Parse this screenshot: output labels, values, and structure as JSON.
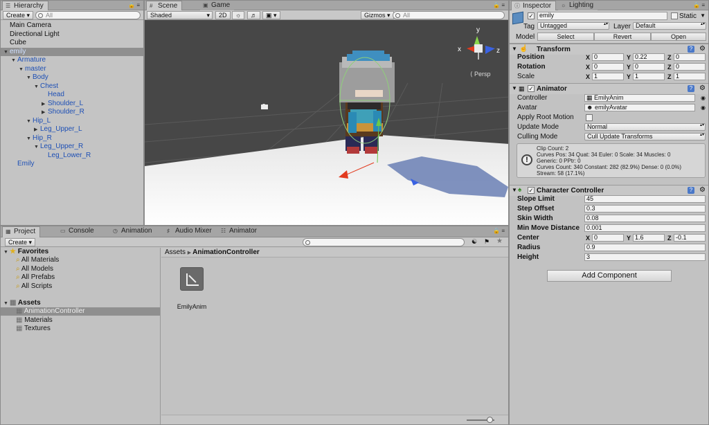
{
  "hierarchy": {
    "tab": "Hierarchy",
    "create": "Create",
    "search_placeholder": "All",
    "items": [
      {
        "label": "Main Camera",
        "indent": 0,
        "arrow": "",
        "blue": false,
        "selected": false
      },
      {
        "label": "Directional Light",
        "indent": 0,
        "arrow": "",
        "blue": false,
        "selected": false
      },
      {
        "label": "Cube",
        "indent": 0,
        "arrow": "",
        "blue": false,
        "selected": false
      },
      {
        "label": "emily",
        "indent": 0,
        "arrow": "down",
        "blue": true,
        "selected": true
      },
      {
        "label": "Armature",
        "indent": 1,
        "arrow": "down",
        "blue": true,
        "selected": false
      },
      {
        "label": "master",
        "indent": 2,
        "arrow": "down",
        "blue": true,
        "selected": false
      },
      {
        "label": "Body",
        "indent": 3,
        "arrow": "down",
        "blue": true,
        "selected": false
      },
      {
        "label": "Chest",
        "indent": 4,
        "arrow": "down",
        "blue": true,
        "selected": false
      },
      {
        "label": "Head",
        "indent": 5,
        "arrow": "",
        "blue": true,
        "selected": false
      },
      {
        "label": "Shoulder_L",
        "indent": 5,
        "arrow": "right",
        "blue": true,
        "selected": false
      },
      {
        "label": "Shoulder_R",
        "indent": 5,
        "arrow": "right",
        "blue": true,
        "selected": false
      },
      {
        "label": "Hip_L",
        "indent": 3,
        "arrow": "down",
        "blue": true,
        "selected": false
      },
      {
        "label": "Leg_Upper_L",
        "indent": 4,
        "arrow": "right",
        "blue": true,
        "selected": false
      },
      {
        "label": "Hip_R",
        "indent": 3,
        "arrow": "down",
        "blue": true,
        "selected": false
      },
      {
        "label": "Leg_Upper_R",
        "indent": 4,
        "arrow": "down",
        "blue": true,
        "selected": false
      },
      {
        "label": "Leg_Lower_R",
        "indent": 5,
        "arrow": "",
        "blue": true,
        "selected": false
      },
      {
        "label": "Emily",
        "indent": 1,
        "arrow": "",
        "blue": true,
        "selected": false
      }
    ]
  },
  "scene": {
    "tabs": [
      "Scene",
      "Game"
    ],
    "shading": "Shaded",
    "mode2d": "2D",
    "gizmos": "Gizmos",
    "search_placeholder": "All",
    "gizmo_axes": {
      "x": "x",
      "y": "y",
      "z": "z"
    },
    "persp": "Persp"
  },
  "inspector": {
    "tabs": [
      "Inspector",
      "Lighting"
    ],
    "object_name": "emily",
    "static_label": "Static",
    "tag_label": "Tag",
    "tag_value": "Untagged",
    "layer_label": "Layer",
    "layer_value": "Default",
    "model_label": "Model",
    "model_buttons": [
      "Select",
      "Revert",
      "Open"
    ],
    "transform": {
      "title": "Transform",
      "rows": [
        {
          "label": "Position",
          "x": "0",
          "y": "0.22",
          "z": "0"
        },
        {
          "label": "Rotation",
          "x": "0",
          "y": "0",
          "z": "0"
        },
        {
          "label": "Scale",
          "x": "1",
          "y": "1",
          "z": "1"
        }
      ]
    },
    "animator": {
      "title": "Animator",
      "controller_label": "Controller",
      "controller_value": "EmilyAnim",
      "avatar_label": "Avatar",
      "avatar_value": "emilyAvatar",
      "root_motion_label": "Apply Root Motion",
      "update_mode_label": "Update Mode",
      "update_mode_value": "Normal",
      "culling_label": "Culling Mode",
      "culling_value": "Cull Update Transforms",
      "info": [
        "Clip Count: 2",
        "Curves Pos: 34 Quat: 34 Euler: 0 Scale: 34 Muscles: 0",
        "Generic: 0 PPtr: 0",
        "Curves Count: 340 Constant: 282 (82.9%) Dense: 0 (0.0%)",
        "Stream: 58 (17.1%)"
      ]
    },
    "character_controller": {
      "title": "Character Controller",
      "slope_label": "Slope Limit",
      "slope_value": "45",
      "step_label": "Step Offset",
      "step_value": "0.3",
      "skin_label": "Skin Width",
      "skin_value": "0.08",
      "min_move_label": "Min Move Distance",
      "min_move_value": "0.001",
      "center_label": "Center",
      "center_x": "0",
      "center_y": "1.6",
      "center_z": "-0.1",
      "radius_label": "Radius",
      "radius_value": "0.9",
      "height_label": "Height",
      "height_value": "3"
    },
    "add_component": "Add Component"
  },
  "project": {
    "tabs": [
      "Project",
      "Console",
      "Animation",
      "Audio Mixer",
      "Animator"
    ],
    "create": "Create",
    "favorites_label": "Favorites",
    "favorites": [
      "All Materials",
      "All Models",
      "All Prefabs",
      "All Scripts"
    ],
    "assets_label": "Assets",
    "folders": [
      "AnimationController",
      "Materials",
      "Textures"
    ],
    "breadcrumb": [
      "Assets",
      "AnimationController"
    ],
    "asset_name": "EmilyAnim"
  }
}
